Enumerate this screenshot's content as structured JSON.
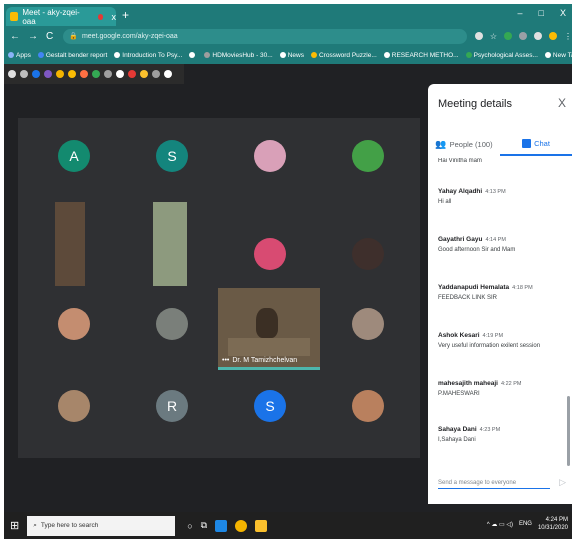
{
  "browser": {
    "tab_title": "Meet - aky-zqei-oaa",
    "tab_close": "x",
    "new_tab": "+",
    "window_controls": [
      "–",
      "□",
      "X"
    ],
    "url": "meet.google.com/aky-zqei-oaa",
    "nav": [
      "←",
      "→",
      "C"
    ],
    "bookmarks": [
      {
        "label": "Apps",
        "color": "#8ab4f8"
      },
      {
        "label": "Gestalt bender report",
        "color": "#4285f4"
      },
      {
        "label": "Introduction To Psy...",
        "color": "#ffffff"
      },
      {
        "label": "",
        "color": "#ffffff"
      },
      {
        "label": "HDMoviesHub - 30...",
        "color": "#9e9e9e"
      },
      {
        "label": "News",
        "color": "#ffffff"
      },
      {
        "label": "Crossword Puzzle...",
        "color": "#fbbc04"
      },
      {
        "label": "RESEARCH METHO...",
        "color": "#ffffff"
      },
      {
        "label": "Psychological Asses...",
        "color": "#34a853"
      },
      {
        "label": "New Tab",
        "color": "#ffffff"
      }
    ],
    "bookmarks_more": "»"
  },
  "extensions": [
    "#e0e0e0",
    "#bdbdbd",
    "#1a73e8",
    "#7e57c2",
    "#f4b400",
    "#fbbc04",
    "#ff7043",
    "#34a853",
    "#9e9e9e",
    "#ffffff",
    "#e53935",
    "#fbc02d",
    "#9e9e9e",
    "#ffffff"
  ],
  "participants": [
    {
      "kind": "letter",
      "letter": "A",
      "color": "#138a6f"
    },
    {
      "kind": "letter",
      "letter": "S",
      "color": "#14857d"
    },
    {
      "kind": "photo",
      "color": "#d9a0b8"
    },
    {
      "kind": "photo",
      "color": "#43a047"
    },
    {
      "kind": "photo",
      "color": "#5d4a3a"
    },
    {
      "kind": "photo",
      "color": "#8d9a7e"
    },
    {
      "kind": "photo",
      "color": "#d84b72"
    },
    {
      "kind": "photo",
      "color": "#3e2f2c"
    },
    {
      "kind": "photo",
      "color": "#c48d70"
    },
    {
      "kind": "photo",
      "color": "#7a7f7a"
    },
    {
      "kind": "photo",
      "color": "#9e8a7c"
    },
    {
      "kind": "photo",
      "color": "#a7866a"
    },
    {
      "kind": "letter",
      "letter": "R",
      "color": "#6b7a80"
    },
    {
      "kind": "letter",
      "letter": "S",
      "color": "#1a73e8"
    },
    {
      "kind": "photo",
      "color": "#b9805e"
    }
  ],
  "featured": {
    "name": "Dr. M Tamizhchelvan",
    "dots": "•••"
  },
  "panel": {
    "title": "Meeting details",
    "close": "X",
    "tab_people": "People (100)",
    "tab_chat": "Chat",
    "messages": [
      {
        "sender": "",
        "time": "",
        "text": "Hai Vinitha mam"
      },
      {
        "sender": "Yahay Alqadhi",
        "time": "4:13 PM",
        "text": "Hi all"
      },
      {
        "sender": "Gayathri Gayu",
        "time": "4:14 PM",
        "text": "Good afternoon Sir and Mam"
      },
      {
        "sender": "Yaddanapudi Hemalata",
        "time": "4:18 PM",
        "text": "FEEDBACK LINK SIR"
      },
      {
        "sender": "Ashok Kesari",
        "time": "4:19 PM",
        "text": "Very useful information exilent session"
      },
      {
        "sender": "mahesajith maheaji",
        "time": "4:22 PM",
        "text": "P.MAHESWARI"
      },
      {
        "sender": "Sahaya Dani",
        "time": "4:23 PM",
        "text": "I,Sahaya Dani"
      }
    ],
    "compose_placeholder": "Send a message to everyone",
    "send": "▷"
  },
  "taskbar": {
    "start": "⊞",
    "search_placeholder": "Type here to search",
    "search_icon": "⌕",
    "lang": "ENG",
    "time": "4:24 PM",
    "date": "10/31/2020",
    "tray": "^ ☁ ▭ ◁)"
  }
}
